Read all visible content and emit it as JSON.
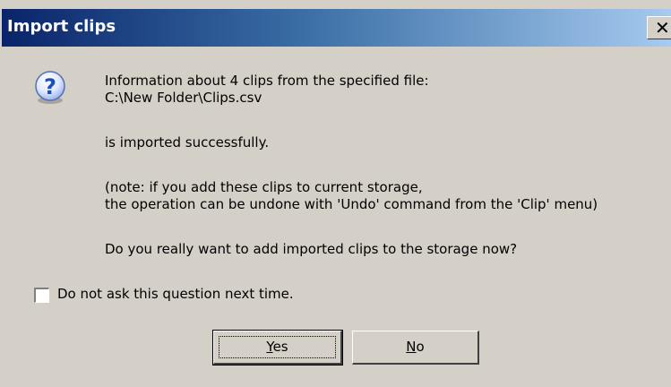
{
  "window": {
    "title": "Import clips",
    "close_glyph": "✕"
  },
  "icon": {
    "name": "question-icon",
    "glyph": "?"
  },
  "message": {
    "line1": "Information about 4 clips from the specified file:",
    "line2": "C:\\New Folder\\Clips.csv",
    "line3": "is imported successfully.",
    "line4": "(note: if you add these clips to current storage,",
    "line5": "the operation can be undone with 'Undo' command from the 'Clip' menu)",
    "question": "Do you really want to add imported clips to the storage now?"
  },
  "checkbox": {
    "label": "Do not ask this question next time.",
    "checked": false
  },
  "buttons": {
    "yes_mnemonic": "Y",
    "yes_rest": "es",
    "no_mnemonic": "N",
    "no_rest": "o"
  },
  "colors": {
    "dialog_bg": "#d4d0c8",
    "title_start": "#0a246a",
    "title_end": "#a6caf0",
    "icon_blue": "#1c4fb8"
  }
}
